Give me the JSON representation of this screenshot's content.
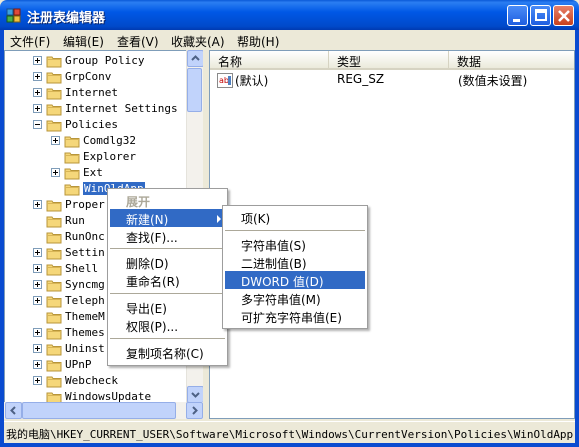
{
  "window": {
    "title": "注册表编辑器",
    "icons": {
      "app": "regedit-icon",
      "minimize": "minimize-icon",
      "maximize": "maximize-icon",
      "close": "close-icon"
    }
  },
  "menubar": {
    "items": [
      {
        "label": "文件(F)"
      },
      {
        "label": "编辑(E)"
      },
      {
        "label": "查看(V)"
      },
      {
        "label": "收藏夹(A)"
      },
      {
        "label": "帮助(H)"
      }
    ]
  },
  "tree": {
    "items": [
      {
        "label": "Group Policy",
        "expand": "plus",
        "level": 0
      },
      {
        "label": "GrpConv",
        "expand": "plus",
        "level": 0
      },
      {
        "label": "Internet",
        "expand": "plus",
        "level": 0
      },
      {
        "label": "Internet Settings",
        "expand": "plus",
        "level": 0
      },
      {
        "label": "Policies",
        "expand": "minus",
        "level": 0
      },
      {
        "label": "Comdlg32",
        "expand": "plus",
        "level": 1
      },
      {
        "label": "Explorer",
        "expand": "none",
        "level": 1
      },
      {
        "label": "Ext",
        "expand": "plus",
        "level": 1
      },
      {
        "label": "WinOldApp",
        "expand": "none",
        "level": 1,
        "selected": true
      },
      {
        "label": "Proper",
        "expand": "plus",
        "level": 0
      },
      {
        "label": "Run",
        "expand": "none",
        "level": 0
      },
      {
        "label": "RunOnc",
        "expand": "none",
        "level": 0
      },
      {
        "label": "Settin",
        "expand": "plus",
        "level": 0
      },
      {
        "label": "Shell",
        "expand": "plus",
        "level": 0
      },
      {
        "label": "Syncmg",
        "expand": "plus",
        "level": 0
      },
      {
        "label": "Teleph",
        "expand": "plus",
        "level": 0
      },
      {
        "label": "ThemeM",
        "expand": "none",
        "level": 0
      },
      {
        "label": "Themes",
        "expand": "plus",
        "level": 0
      },
      {
        "label": "Uninst",
        "expand": "plus",
        "level": 0
      },
      {
        "label": "UPnP",
        "expand": "plus",
        "level": 0
      },
      {
        "label": "Webcheck",
        "expand": "plus",
        "level": 0
      },
      {
        "label": "WindowsUpdate",
        "expand": "none",
        "level": 0
      }
    ]
  },
  "list": {
    "columns": [
      {
        "label": "名称"
      },
      {
        "label": "类型"
      },
      {
        "label": "数据"
      }
    ],
    "rows": [
      {
        "name": "(默认)",
        "type": "REG_SZ",
        "data": "(数值未设置)",
        "icon": "reg-string-icon"
      }
    ]
  },
  "context_menu": {
    "items": [
      {
        "label": "展开",
        "state": "disabled"
      },
      {
        "label": "新建(N)",
        "state": "highlighted",
        "submenu": true
      },
      {
        "label": "查找(F)..."
      },
      {
        "separator": true
      },
      {
        "label": "删除(D)"
      },
      {
        "label": "重命名(R)"
      },
      {
        "separator": true
      },
      {
        "label": "导出(E)"
      },
      {
        "label": "权限(P)..."
      },
      {
        "separator": true
      },
      {
        "label": "复制项名称(C)"
      }
    ]
  },
  "submenu": {
    "items": [
      {
        "label": "项(K)"
      },
      {
        "separator": true
      },
      {
        "label": "字符串值(S)"
      },
      {
        "label": "二进制值(B)"
      },
      {
        "label": "DWORD 值(D)",
        "state": "highlighted"
      },
      {
        "label": "多字符串值(M)"
      },
      {
        "label": "可扩充字符串值(E)"
      }
    ]
  },
  "statusbar": {
    "path": "我的电脑\\HKEY_CURRENT_USER\\Software\\Microsoft\\Windows\\CurrentVersion\\Policies\\WinOldApp"
  },
  "colors": {
    "titlebar": "#0058e6",
    "selection": "#316ac5",
    "frame": "#0a4bd0"
  }
}
